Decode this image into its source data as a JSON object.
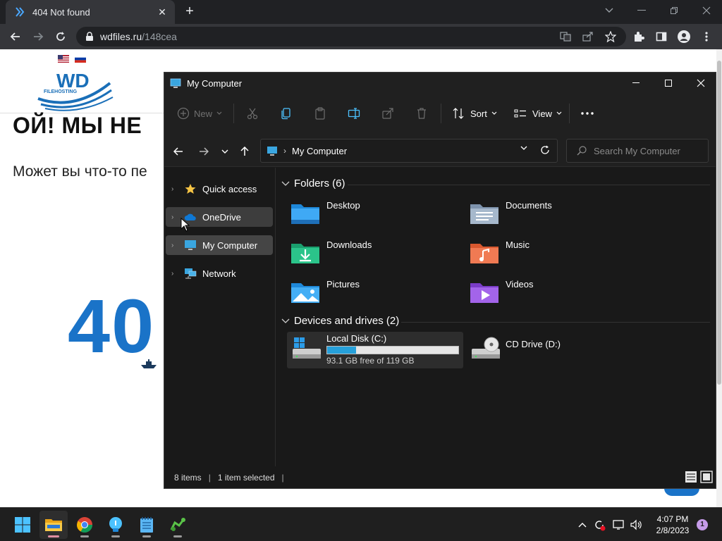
{
  "browser": {
    "tab_title": "404 Not found",
    "url_host": "wdfiles.ru",
    "url_path": "/148cea"
  },
  "webpage": {
    "logo_text": "WD",
    "logo_subtext": "FILEHOSTING",
    "heading": "ОЙ! МЫ НЕ",
    "subtext": "Может вы что-то пе",
    "big_number": "40"
  },
  "explorer": {
    "title": "My Computer",
    "commands": {
      "new": "New",
      "sort": "Sort",
      "view": "View"
    },
    "address": "My Computer",
    "search_placeholder": "Search My Computer",
    "nav_items": [
      {
        "label": "Quick access"
      },
      {
        "label": "OneDrive"
      },
      {
        "label": "My Computer"
      },
      {
        "label": "Network"
      }
    ],
    "folders_header": "Folders (6)",
    "folders": [
      {
        "label": "Desktop",
        "icon": "desktop-folder-icon"
      },
      {
        "label": "Documents",
        "icon": "documents-folder-icon"
      },
      {
        "label": "Downloads",
        "icon": "downloads-folder-icon"
      },
      {
        "label": "Music",
        "icon": "music-folder-icon"
      },
      {
        "label": "Pictures",
        "icon": "pictures-folder-icon"
      },
      {
        "label": "Videos",
        "icon": "videos-folder-icon"
      }
    ],
    "drives_header": "Devices and drives (2)",
    "drives": [
      {
        "label": "Local Disk (C:)",
        "free": "93.1 GB free of 119 GB",
        "used_fraction": 0.22
      },
      {
        "label": "CD Drive (D:)"
      }
    ],
    "status": {
      "items": "8 items",
      "selected": "1 item selected"
    }
  },
  "taskbar": {
    "time": "4:07 PM",
    "date": "2/8/2023",
    "notifications": "1"
  },
  "colors": {
    "accent": "#26a0da",
    "chrome_dark": "#202124",
    "explorer_bg": "#191919"
  }
}
